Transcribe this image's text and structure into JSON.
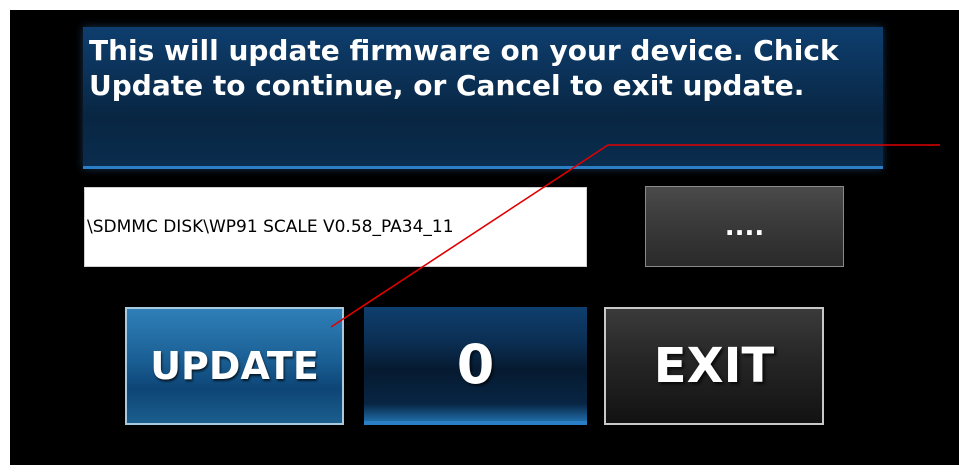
{
  "dialog": {
    "message": "This will update firmware on your device. Chick Update to continue, or Cancel to exit update."
  },
  "file": {
    "path": "\\SDMMC DISK\\WP91 SCALE V0.58_PA34_11",
    "browse_label": "...."
  },
  "actions": {
    "update_label": "UPDATE",
    "counter_value": "0",
    "exit_label": "EXIT"
  },
  "colors": {
    "panel_blue": "#0b3157",
    "update_blue": "#1a5f94",
    "annotation_line": "#e00000"
  }
}
